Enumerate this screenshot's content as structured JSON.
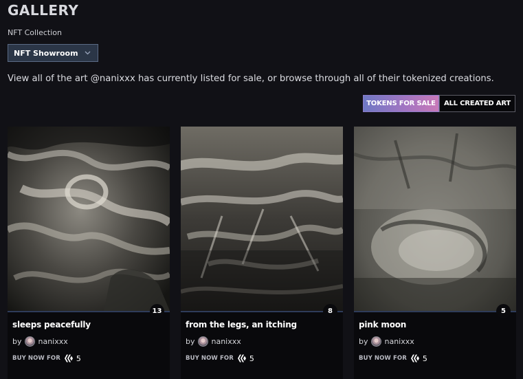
{
  "page": {
    "title": "GALLERY",
    "collection_label": "NFT Collection",
    "collection_selected": "NFT Showroom",
    "description": "View all of the art @nanixxx has currently listed for sale, or browse through all of their tokenized creations."
  },
  "toggle": {
    "sale_label": "TOKENS FOR SALE",
    "all_label": "ALL CREATED ART",
    "active": "TOKENS FOR SALE"
  },
  "colors": {
    "background": "#111116",
    "select_bg": "#2b3647",
    "gradient_start": "#6f79c5",
    "gradient_end": "#c879b8"
  },
  "cards": [
    {
      "title": "sleeps peacefully",
      "badge": "13",
      "by": "by",
      "author": "nanixxx",
      "buy_label": "BUY NOW FOR",
      "price": "5",
      "currency_icon": "hive-icon"
    },
    {
      "title": "from the legs, an itching",
      "badge": "8",
      "by": "by",
      "author": "nanixxx",
      "buy_label": "BUY NOW FOR",
      "price": "5",
      "currency_icon": "hive-icon"
    },
    {
      "title": "pink moon",
      "badge": "5",
      "by": "by",
      "author": "nanixxx",
      "buy_label": "BUY NOW FOR",
      "price": "5",
      "currency_icon": "hive-icon"
    }
  ]
}
